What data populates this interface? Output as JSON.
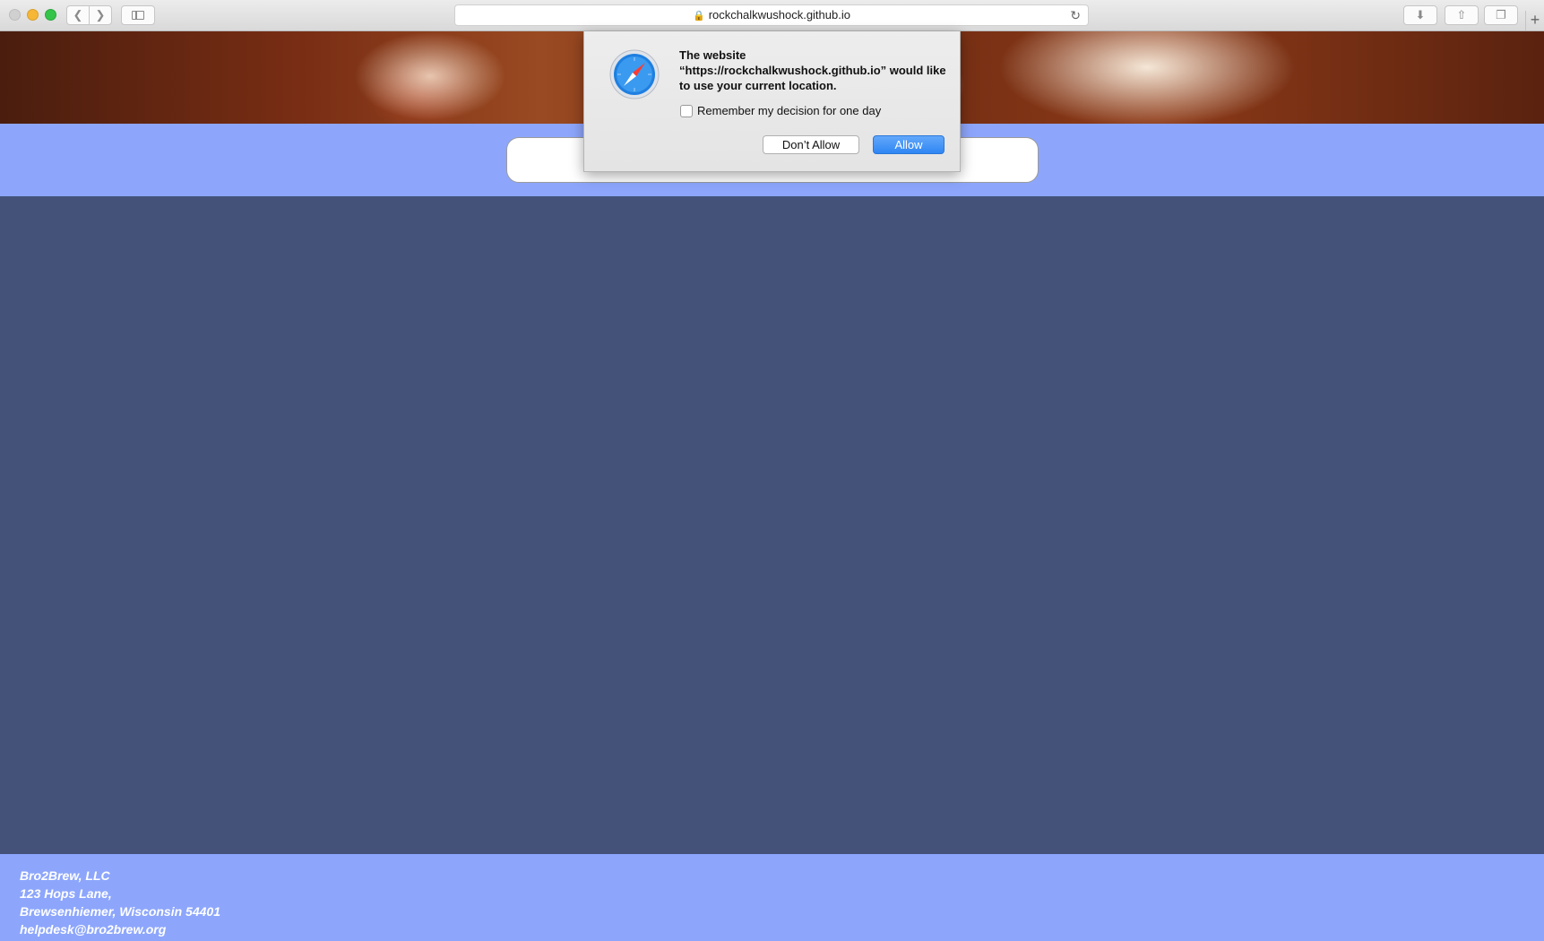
{
  "browser": {
    "address": "rockchalkwushock.github.io",
    "icons": {
      "back": "chevron-left-icon",
      "forward": "chevron-right-icon",
      "sidebar": "sidebar-icon",
      "lock": "lock-icon",
      "reload": "reload-icon",
      "downloads": "download-icon",
      "share": "share-icon",
      "tabs": "tabs-icon",
      "new_tab": "plus-icon"
    }
  },
  "dialog": {
    "message": "The website “https://rockchalkwushock.github.io” would like to use your current location.",
    "remember_label": "Remember my decision for one day",
    "remember_checked": false,
    "deny_label": "Don’t Allow",
    "allow_label": "Allow",
    "icon": "safari-compass-icon"
  },
  "search": {
    "value": "",
    "placeholder": ""
  },
  "footer": {
    "company": "Bro2Brew, LLC",
    "street": "123 Hops Lane,",
    "city": "Brewsenhiemer, Wisconsin 54401",
    "email": "helpdesk@bro2brew.org"
  },
  "colors": {
    "band": "#8da6fc",
    "main": "#44527a",
    "allow_button": "#2f86f3"
  }
}
